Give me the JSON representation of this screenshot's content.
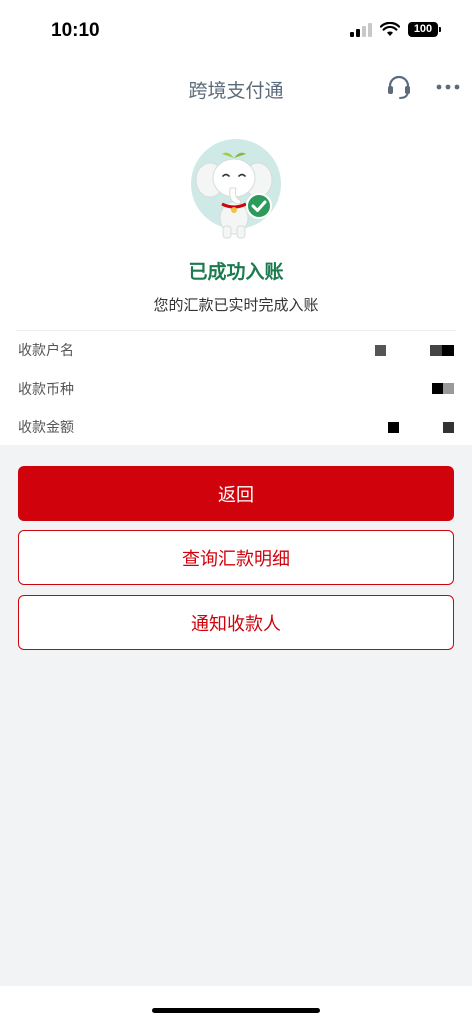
{
  "status": {
    "time": "10:10",
    "battery": "100"
  },
  "nav": {
    "title": "跨境支付通",
    "icons": [
      "headset-icon",
      "more-icon"
    ]
  },
  "result": {
    "title": "已成功入账",
    "subtitle": "您的汇款已实时完成入账"
  },
  "info": [
    {
      "label": "收款户名"
    },
    {
      "label": "收款币种"
    },
    {
      "label": "收款金额"
    }
  ],
  "actions": {
    "back": "返回",
    "query": "查询汇款明细",
    "notify": "通知收款人"
  },
  "colors": {
    "primary": "#d0020c",
    "success": "#1b7a4e",
    "nav_title": "#5c6b7c"
  }
}
